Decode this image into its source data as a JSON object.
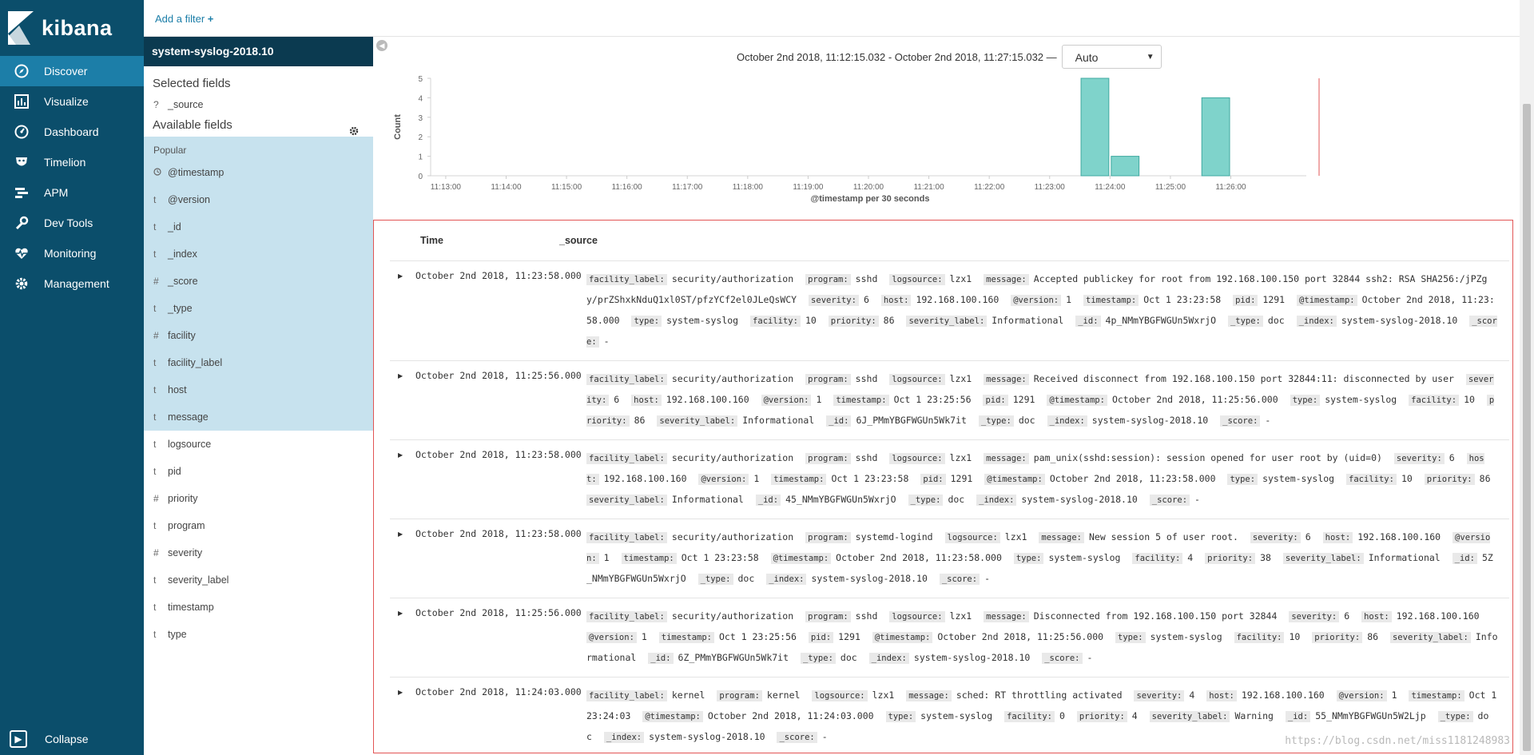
{
  "app": {
    "name": "kibana"
  },
  "nav": {
    "items": [
      {
        "label": "Discover",
        "icon": "compass-icon",
        "active": true
      },
      {
        "label": "Visualize",
        "icon": "bar-chart-icon",
        "active": false
      },
      {
        "label": "Dashboard",
        "icon": "dashboard-gauge-icon",
        "active": false
      },
      {
        "label": "Timelion",
        "icon": "timelion-mask-icon",
        "active": false
      },
      {
        "label": "APM",
        "icon": "apm-bars-icon",
        "active": false
      },
      {
        "label": "Dev Tools",
        "icon": "wrench-icon",
        "active": false
      },
      {
        "label": "Monitoring",
        "icon": "heartbeat-icon",
        "active": false
      },
      {
        "label": "Management",
        "icon": "gear-icon",
        "active": false
      }
    ],
    "collapse_label": "Collapse"
  },
  "filterbar": {
    "add_filter": "Add a filter"
  },
  "sidebar": {
    "index_pattern": "system-syslog-2018.10",
    "selected_fields_title": "Selected fields",
    "selected_fields": [
      {
        "type": "?",
        "name": "_source"
      }
    ],
    "available_fields_title": "Available fields",
    "popular_title": "Popular",
    "popular_fields": [
      {
        "type": "clock",
        "name": "@timestamp"
      },
      {
        "type": "t",
        "name": "@version"
      },
      {
        "type": "t",
        "name": "_id"
      },
      {
        "type": "t",
        "name": "_index"
      },
      {
        "type": "#",
        "name": "_score"
      },
      {
        "type": "t",
        "name": "_type"
      },
      {
        "type": "#",
        "name": "facility"
      },
      {
        "type": "t",
        "name": "facility_label"
      },
      {
        "type": "t",
        "name": "host"
      },
      {
        "type": "t",
        "name": "message"
      }
    ],
    "other_fields": [
      {
        "type": "t",
        "name": "logsource"
      },
      {
        "type": "t",
        "name": "pid"
      },
      {
        "type": "#",
        "name": "priority"
      },
      {
        "type": "t",
        "name": "program"
      },
      {
        "type": "#",
        "name": "severity"
      },
      {
        "type": "t",
        "name": "severity_label"
      },
      {
        "type": "t",
        "name": "timestamp"
      },
      {
        "type": "t",
        "name": "type"
      }
    ]
  },
  "timepicker": {
    "range": "October 2nd 2018, 11:12:15.032 - October 2nd 2018, 11:27:15.032 —",
    "interval": "Auto"
  },
  "chart_data": {
    "type": "bar",
    "x": [
      "11:23:30",
      "11:24:00",
      "11:25:30"
    ],
    "values": [
      5,
      1,
      4
    ],
    "x_ticks": [
      "11:13:00",
      "11:14:00",
      "11:15:00",
      "11:16:00",
      "11:17:00",
      "11:18:00",
      "11:19:00",
      "11:20:00",
      "11:21:00",
      "11:22:00",
      "11:23:00",
      "11:24:00",
      "11:25:00",
      "11:26:00"
    ],
    "y_ticks": [
      0,
      1,
      2,
      3,
      4,
      5
    ],
    "ylim": [
      0,
      5
    ],
    "xlabel": "@timestamp per 30 seconds",
    "ylabel": "Count",
    "bar_color": "#7fd3cb",
    "now_line_color": "#e25555"
  },
  "table": {
    "headers": [
      "Time",
      "_source"
    ],
    "rows": [
      {
        "time": "October 2nd 2018, 11:23:58.000",
        "fields": [
          [
            "facility_label:",
            "security/authorization"
          ],
          [
            "program:",
            "sshd"
          ],
          [
            "logsource:",
            "lzx1"
          ],
          [
            "message:",
            "Accepted publickey for root from 192.168.100.150 port 32844 ssh2: RSA SHA256:/jPZgy/prZShxkNduQ1xl0ST/pfzYCf2el0JLeQsWCY"
          ],
          [
            "severity:",
            "6"
          ],
          [
            "host:",
            "192.168.100.160"
          ],
          [
            "@version:",
            "1"
          ],
          [
            "timestamp:",
            "Oct 1 23:23:58"
          ],
          [
            "pid:",
            "1291"
          ],
          [
            "@timestamp:",
            "October 2nd 2018, 11:23:58.000"
          ],
          [
            "type:",
            "system-syslog"
          ],
          [
            "facility:",
            "10"
          ],
          [
            "priority:",
            "86"
          ],
          [
            "severity_label:",
            "Informational"
          ],
          [
            "_id:",
            "4p_NMmYBGFWGUn5WxrjO"
          ],
          [
            "_type:",
            "doc"
          ],
          [
            "_index:",
            "system-syslog-2018.10"
          ],
          [
            "_score:",
            "-"
          ]
        ]
      },
      {
        "time": "October 2nd 2018, 11:25:56.000",
        "fields": [
          [
            "facility_label:",
            "security/authorization"
          ],
          [
            "program:",
            "sshd"
          ],
          [
            "logsource:",
            "lzx1"
          ],
          [
            "message:",
            "Received disconnect from 192.168.100.150 port 32844:11: disconnected by user"
          ],
          [
            "severity:",
            "6"
          ],
          [
            "host:",
            "192.168.100.160"
          ],
          [
            "@version:",
            "1"
          ],
          [
            "timestamp:",
            "Oct 1 23:25:56"
          ],
          [
            "pid:",
            "1291"
          ],
          [
            "@timestamp:",
            "October 2nd 2018, 11:25:56.000"
          ],
          [
            "type:",
            "system-syslog"
          ],
          [
            "facility:",
            "10"
          ],
          [
            "priority:",
            "86"
          ],
          [
            "severity_label:",
            "Informational"
          ],
          [
            "_id:",
            "6J_PMmYBGFWGUn5Wk7it"
          ],
          [
            "_type:",
            "doc"
          ],
          [
            "_index:",
            "system-syslog-2018.10"
          ],
          [
            "_score:",
            "-"
          ]
        ]
      },
      {
        "time": "October 2nd 2018, 11:23:58.000",
        "fields": [
          [
            "facility_label:",
            "security/authorization"
          ],
          [
            "program:",
            "sshd"
          ],
          [
            "logsource:",
            "lzx1"
          ],
          [
            "message:",
            "pam_unix(sshd:session): session opened for user root by (uid=0)"
          ],
          [
            "severity:",
            "6"
          ],
          [
            "host:",
            "192.168.100.160"
          ],
          [
            "@version:",
            "1"
          ],
          [
            "timestamp:",
            "Oct 1 23:23:58"
          ],
          [
            "pid:",
            "1291"
          ],
          [
            "@timestamp:",
            "October 2nd 2018, 11:23:58.000"
          ],
          [
            "type:",
            "system-syslog"
          ],
          [
            "facility:",
            "10"
          ],
          [
            "priority:",
            "86"
          ],
          [
            "severity_label:",
            "Informational"
          ],
          [
            "_id:",
            "45_NMmYBGFWGUn5WxrjO"
          ],
          [
            "_type:",
            "doc"
          ],
          [
            "_index:",
            "system-syslog-2018.10"
          ],
          [
            "_score:",
            "-"
          ]
        ]
      },
      {
        "time": "October 2nd 2018, 11:23:58.000",
        "fields": [
          [
            "facility_label:",
            "security/authorization"
          ],
          [
            "program:",
            "systemd-logind"
          ],
          [
            "logsource:",
            "lzx1"
          ],
          [
            "message:",
            "New session 5 of user root."
          ],
          [
            "severity:",
            "6"
          ],
          [
            "host:",
            "192.168.100.160"
          ],
          [
            "@version:",
            "1"
          ],
          [
            "timestamp:",
            "Oct 1 23:23:58"
          ],
          [
            "@timestamp:",
            "October 2nd 2018, 11:23:58.000"
          ],
          [
            "type:",
            "system-syslog"
          ],
          [
            "facility:",
            "4"
          ],
          [
            "priority:",
            "38"
          ],
          [
            "severity_label:",
            "Informational"
          ],
          [
            "_id:",
            "5Z_NMmYBGFWGUn5WxrjO"
          ],
          [
            "_type:",
            "doc"
          ],
          [
            "_index:",
            "system-syslog-2018.10"
          ],
          [
            "_score:",
            "-"
          ]
        ]
      },
      {
        "time": "October 2nd 2018, 11:25:56.000",
        "fields": [
          [
            "facility_label:",
            "security/authorization"
          ],
          [
            "program:",
            "sshd"
          ],
          [
            "logsource:",
            "lzx1"
          ],
          [
            "message:",
            "Disconnected from 192.168.100.150 port 32844"
          ],
          [
            "severity:",
            "6"
          ],
          [
            "host:",
            "192.168.100.160"
          ],
          [
            "@version:",
            "1"
          ],
          [
            "timestamp:",
            "Oct 1 23:25:56"
          ],
          [
            "pid:",
            "1291"
          ],
          [
            "@timestamp:",
            "October 2nd 2018, 11:25:56.000"
          ],
          [
            "type:",
            "system-syslog"
          ],
          [
            "facility:",
            "10"
          ],
          [
            "priority:",
            "86"
          ],
          [
            "severity_label:",
            "Informational"
          ],
          [
            "_id:",
            "6Z_PMmYBGFWGUn5Wk7it"
          ],
          [
            "_type:",
            "doc"
          ],
          [
            "_index:",
            "system-syslog-2018.10"
          ],
          [
            "_score:",
            "-"
          ]
        ]
      },
      {
        "time": "October 2nd 2018, 11:24:03.000",
        "fields": [
          [
            "facility_label:",
            "kernel"
          ],
          [
            "program:",
            "kernel"
          ],
          [
            "logsource:",
            "lzx1"
          ],
          [
            "message:",
            "sched: RT throttling activated"
          ],
          [
            "severity:",
            "4"
          ],
          [
            "host:",
            "192.168.100.160"
          ],
          [
            "@version:",
            "1"
          ],
          [
            "timestamp:",
            "Oct 1 23:24:03"
          ],
          [
            "@timestamp:",
            "October 2nd 2018, 11:24:03.000"
          ],
          [
            "type:",
            "system-syslog"
          ],
          [
            "facility:",
            "0"
          ],
          [
            "priority:",
            "4"
          ],
          [
            "severity_label:",
            "Warning"
          ],
          [
            "_id:",
            "55_NMmYBGFWGUn5W2Ljp"
          ],
          [
            "_type:",
            "doc"
          ],
          [
            "_index:",
            "system-syslog-2018.10"
          ],
          [
            "_score:",
            "-"
          ]
        ]
      }
    ]
  },
  "watermark": "https://blog.csdn.net/miss1181248983"
}
